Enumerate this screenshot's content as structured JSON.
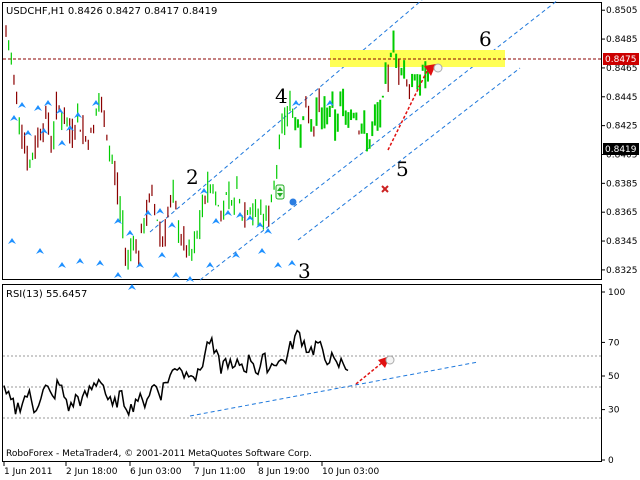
{
  "window": {
    "symbol_header": "USDCHF,H1  0.8426 0.8427 0.8417 0.8419",
    "footer": "RoboForex - MetaTrader4, © 2001-2011 MetaQuotes Software Corp."
  },
  "colors": {
    "background": "#ffffff",
    "bull": "#00cc00",
    "bear": "#8b0000",
    "fractal": "#1e90ff",
    "channel": "#1e78dc",
    "highlight": "#ffff55",
    "level_line": "#8b0000",
    "arrow": "#e01010"
  },
  "icons": [
    "fractal-arrow-icon",
    "buy-signal-icon",
    "arrow-target-icon",
    "cross-marker-icon"
  ],
  "price_axis": {
    "ticks": [
      "0.8505",
      "0.8485",
      "0.8465",
      "0.8445",
      "0.8425",
      "0.8405",
      "0.8385",
      "0.8365",
      "0.8345",
      "0.8325"
    ],
    "level_label": "0.8475",
    "current_label": "0.8419"
  },
  "rsi": {
    "label": "RSI(13) 55.6457",
    "ticks": [
      "100",
      "70",
      "50",
      "30",
      "0"
    ]
  },
  "time_axis": {
    "labels": [
      "1 Jun 2011",
      "2 Jun 18:00",
      "6 Jun 03:00",
      "7 Jun 11:00",
      "8 Jun 19:00",
      "10 Jun 03:00"
    ]
  },
  "wave_labels": [
    "2",
    "3",
    "4",
    "5",
    "6"
  ],
  "chart_data": {
    "type": "line",
    "title": "USDCHF,H1",
    "ohlc_header": {
      "open": 0.8426,
      "high": 0.8427,
      "low": 0.8417,
      "close": 0.8419
    },
    "price_range": [
      0.8318,
      0.851
    ],
    "resistance_level": 0.8475,
    "highlight_zone": [
      0.847,
      0.848
    ],
    "current_price": 0.8419,
    "rsi_period": 13,
    "rsi_value": 55.6457,
    "rsi_range": [
      0,
      100
    ],
    "rsi_levels": [
      70,
      50,
      30
    ],
    "series": [
      {
        "name": "USDCHF,H1",
        "values": [
          0.8488,
          0.8468,
          0.844,
          0.842,
          0.8395,
          0.841,
          0.8425,
          0.843,
          0.8415,
          0.844,
          0.843,
          0.842,
          0.843,
          0.8425,
          0.8415,
          0.842,
          0.844,
          0.843,
          0.8405,
          0.839,
          0.836,
          0.833,
          0.835,
          0.8335,
          0.836,
          0.8375,
          0.8365,
          0.8345,
          0.8365,
          0.8372,
          0.8352,
          0.834,
          0.833,
          0.8345,
          0.8368,
          0.8385,
          0.838,
          0.8365,
          0.8373,
          0.8368,
          0.8378,
          0.8362,
          0.8372,
          0.836,
          0.8368,
          0.8358,
          0.8382,
          0.84,
          0.8425,
          0.844,
          0.843,
          0.842,
          0.8435,
          0.8418,
          0.844,
          0.843,
          0.8436,
          0.8428,
          0.844,
          0.8432,
          0.8438,
          0.8425,
          0.842,
          0.8412,
          0.843,
          0.8435,
          0.846,
          0.8478,
          0.8465,
          0.8458,
          0.845,
          0.8455,
          0.846,
          0.8462
        ]
      },
      {
        "name": "RSI(13)",
        "values": [
          40,
          35,
          30,
          35,
          40,
          30,
          38,
          43,
          36,
          46,
          38,
          30,
          38,
          35,
          40,
          45,
          50,
          38,
          30,
          38,
          35,
          30,
          38,
          33,
          40,
          45,
          40,
          48,
          52,
          58,
          50,
          55,
          48,
          60,
          72,
          62,
          55,
          60,
          52,
          58,
          55,
          62,
          52,
          60,
          55,
          60,
          58,
          62,
          72,
          75,
          68,
          65,
          70,
          60,
          62,
          55,
          58,
          56
        ]
      }
    ],
    "wave_points": [
      {
        "label": "2",
        "price": 0.839
      },
      {
        "label": "3",
        "price": 0.835
      },
      {
        "label": "4",
        "price": 0.845
      },
      {
        "label": "5",
        "price": 0.8412
      },
      {
        "label": "6",
        "price": 0.8475
      }
    ],
    "forecast_arrow_to": 0.8468
  }
}
